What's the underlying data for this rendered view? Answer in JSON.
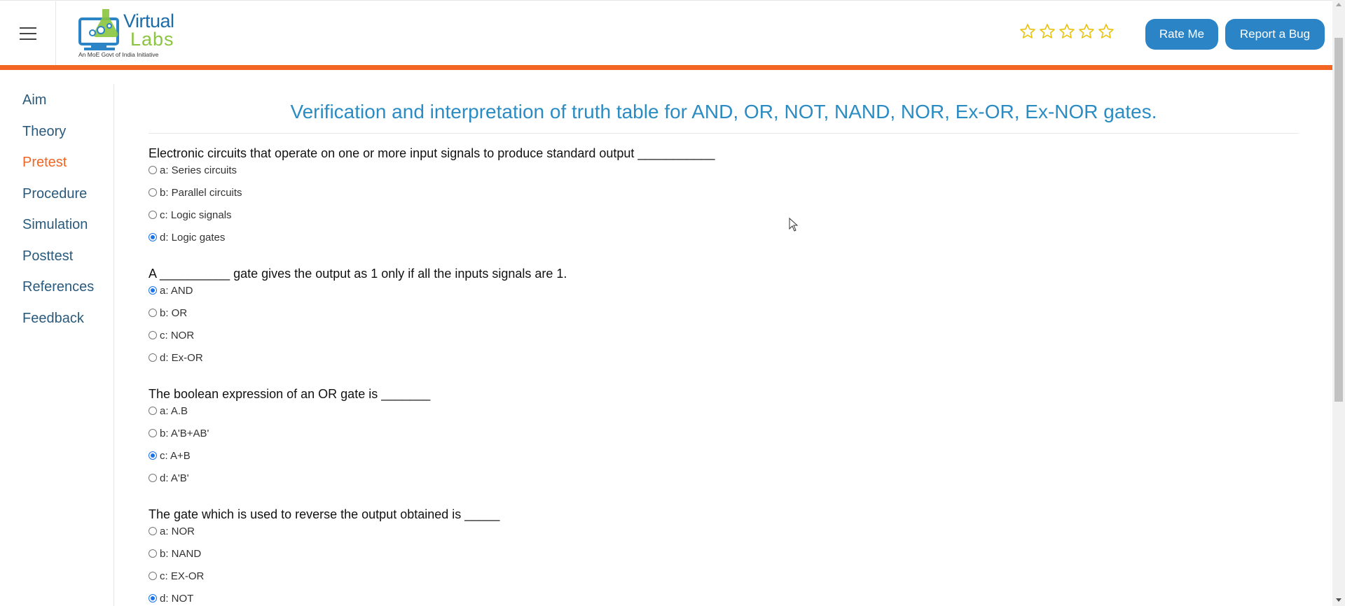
{
  "header": {
    "menu_icon": "hamburger-icon",
    "logo": {
      "word1": "Virtual",
      "word2": "Labs",
      "tagline": "An MoE Govt of India Initiative"
    },
    "rating": {
      "max_stars": 5,
      "value": 0,
      "star_color": "#e8c10a"
    },
    "rate_label": "Rate Me",
    "bug_label": "Report a Bug"
  },
  "colors": {
    "accent_orange": "#f26522",
    "button_blue": "#2b84c6",
    "title_blue": "#2b8cc4",
    "nav_text": "#2a5a7c"
  },
  "sidebar": {
    "items": [
      {
        "label": "Aim",
        "active": false
      },
      {
        "label": "Theory",
        "active": false
      },
      {
        "label": "Pretest",
        "active": true
      },
      {
        "label": "Procedure",
        "active": false
      },
      {
        "label": "Simulation",
        "active": false
      },
      {
        "label": "Posttest",
        "active": false
      },
      {
        "label": "References",
        "active": false
      },
      {
        "label": "Feedback",
        "active": false
      }
    ]
  },
  "main": {
    "title": "Verification and interpretation of truth table for AND, OR, NOT, NAND, NOR, Ex-OR, Ex-NOR gates.",
    "questions": [
      {
        "text": "Electronic circuits that operate on one or more input signals to produce standard output ___________",
        "options": [
          "a: Series circuits",
          "b: Parallel circuits",
          "c: Logic signals",
          "d: Logic gates"
        ],
        "selected": 3
      },
      {
        "text": "A __________ gate gives the output as 1 only if all the inputs signals are 1.",
        "options": [
          "a: AND",
          "b: OR",
          "c: NOR",
          "d: Ex-OR"
        ],
        "selected": 0
      },
      {
        "text": "The boolean expression of an OR gate is _______",
        "options": [
          "a: A.B",
          "b: A'B+AB'",
          "c: A+B",
          "d: A'B'"
        ],
        "selected": 2
      },
      {
        "text": "The gate which is used to reverse the output obtained is _____",
        "options": [
          "a: NOR",
          "b: NAND",
          "c: EX-OR",
          "d: NOT"
        ],
        "selected": 3
      }
    ]
  }
}
